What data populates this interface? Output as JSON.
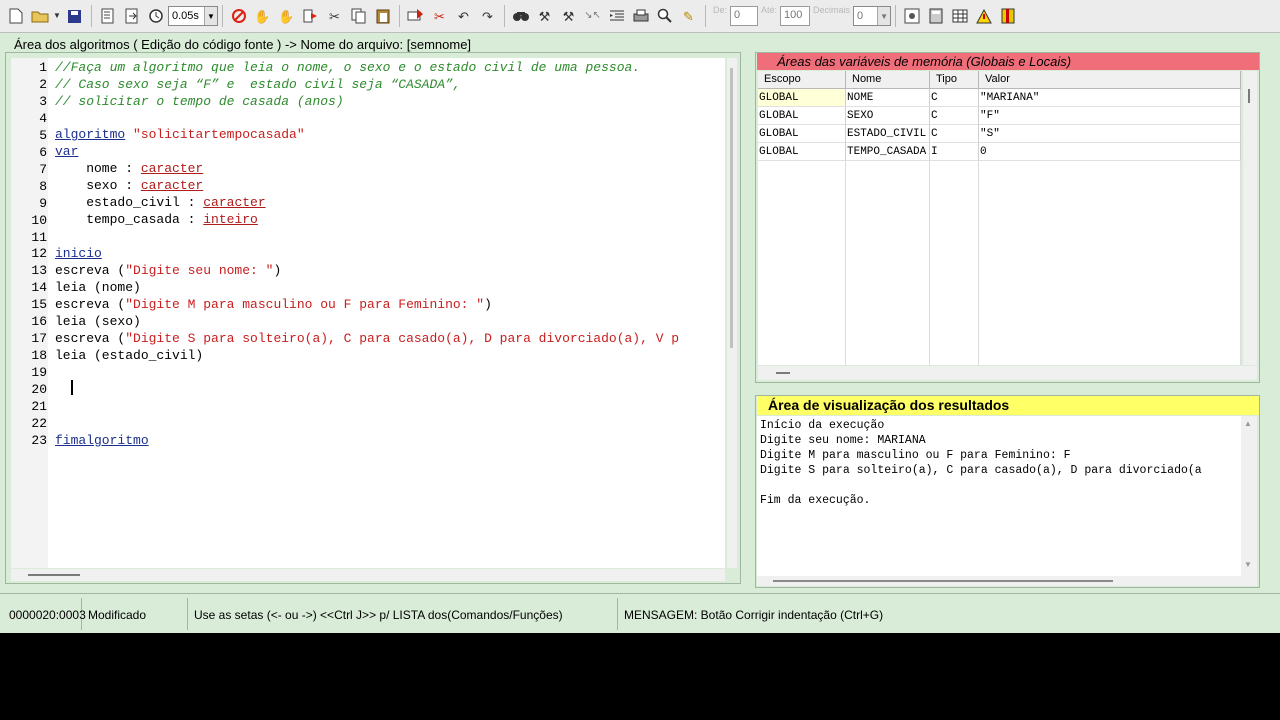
{
  "toolbar": {
    "speed_value": "0.05s",
    "de_label": "De:",
    "de_value": "0",
    "ate_label": "Até:",
    "ate_value": "100",
    "decimais_label": "Decimais",
    "decimais_value": "0"
  },
  "code_panel": {
    "title": "Área dos algoritmos ( Edição do código fonte ) -> Nome do arquivo: [semnome]",
    "line_numbers": [
      "1",
      "2",
      "3",
      "4",
      "5",
      "6",
      "7",
      "8",
      "9",
      "10",
      "11",
      "12",
      "13",
      "14",
      "15",
      "16",
      "17",
      "18",
      "19",
      "20",
      "21",
      "22",
      "23"
    ],
    "lines": {
      "l1": "//Faça um algoritmo que leia o nome, o sexo e o estado civil de uma pessoa.",
      "l2": "// Caso sexo seja “F” e  estado civil seja “CASADA”,",
      "l3": "// solicitar o tempo de casada (anos)",
      "l5_kw": "algoritmo",
      "l5_str": "\"solicitartempocasada\"",
      "l6_kw": "var",
      "l7_name": "    nome : ",
      "l7_type": "caracter",
      "l8_name": "    sexo : ",
      "l8_type": "caracter",
      "l9_name": "    estado_civil : ",
      "l9_type": "caracter",
      "l10_name": "    tempo_casada : ",
      "l10_type": "inteiro",
      "l12_kw": "inicio",
      "l13_cmd": "escreva (",
      "l13_str": "\"Digite seu nome: \"",
      "l13_end": ")",
      "l14": "leia (nome)",
      "l15_cmd": "escreva (",
      "l15_str": "\"Digite M para masculino ou F para Feminino: \"",
      "l15_end": ")",
      "l16": "leia (sexo)",
      "l17_cmd": "escreva (",
      "l17_str": "\"Digite S para solteiro(a), C para casado(a), D para divorciado(a), V p",
      "l18": "leia (estado_civil)",
      "l23_kw": "fimalgoritmo"
    }
  },
  "variables_panel": {
    "title": "Áreas das variáveis de memória (Globais e Locais)",
    "columns": [
      "Escopo",
      "Nome",
      "Tipo",
      "Valor"
    ],
    "rows": [
      {
        "escopo": "GLOBAL",
        "nome": "NOME",
        "tipo": "C",
        "valor": "\"MARIANA\""
      },
      {
        "escopo": "GLOBAL",
        "nome": "SEXO",
        "tipo": "C",
        "valor": "\"F\""
      },
      {
        "escopo": "GLOBAL",
        "nome": "ESTADO_CIVIL",
        "tipo": "C",
        "valor": "\"S\""
      },
      {
        "escopo": "GLOBAL",
        "nome": "TEMPO_CASADA",
        "tipo": "I",
        "valor": "0"
      }
    ]
  },
  "output_panel": {
    "title": "Área de visualização dos resultados",
    "lines": [
      "Início da execução",
      "Digite seu nome: MARIANA",
      "Digite M para masculino ou F para Feminino: F",
      "Digite S para solteiro(a), C para casado(a), D para divorciado(a",
      "",
      "Fim da execução."
    ]
  },
  "statusbar": {
    "position": "0000020:0003",
    "state": "Modificado",
    "hint": "Use as setas (<- ou ->) <<Ctrl J>> p/ LISTA dos(Comandos/Funções)",
    "message": "MENSAGEM: Botão Corrigir indentação (Ctrl+G)"
  },
  "colors": {
    "background": "#d8ecd8",
    "var_title_bg": "#f06e7a",
    "out_title_bg": "#ffff66",
    "comment": "#2e8b2e",
    "keyword": "#1b2f8c",
    "string": "#c81e1e"
  },
  "icons": [
    "new-file-icon",
    "open-folder-icon",
    "save-icon",
    "run-icon",
    "step-icon",
    "timer-icon",
    "stop-icon",
    "hand-icon",
    "breakpoint-icon",
    "run-to-icon",
    "cut-icon",
    "copy-icon",
    "paste-icon",
    "undo-icon",
    "redo-icon",
    "find-icon",
    "indent-icon",
    "print-icon",
    "zoom-icon",
    "calculator-icon",
    "table-icon",
    "warning-icon",
    "book-icon"
  ]
}
